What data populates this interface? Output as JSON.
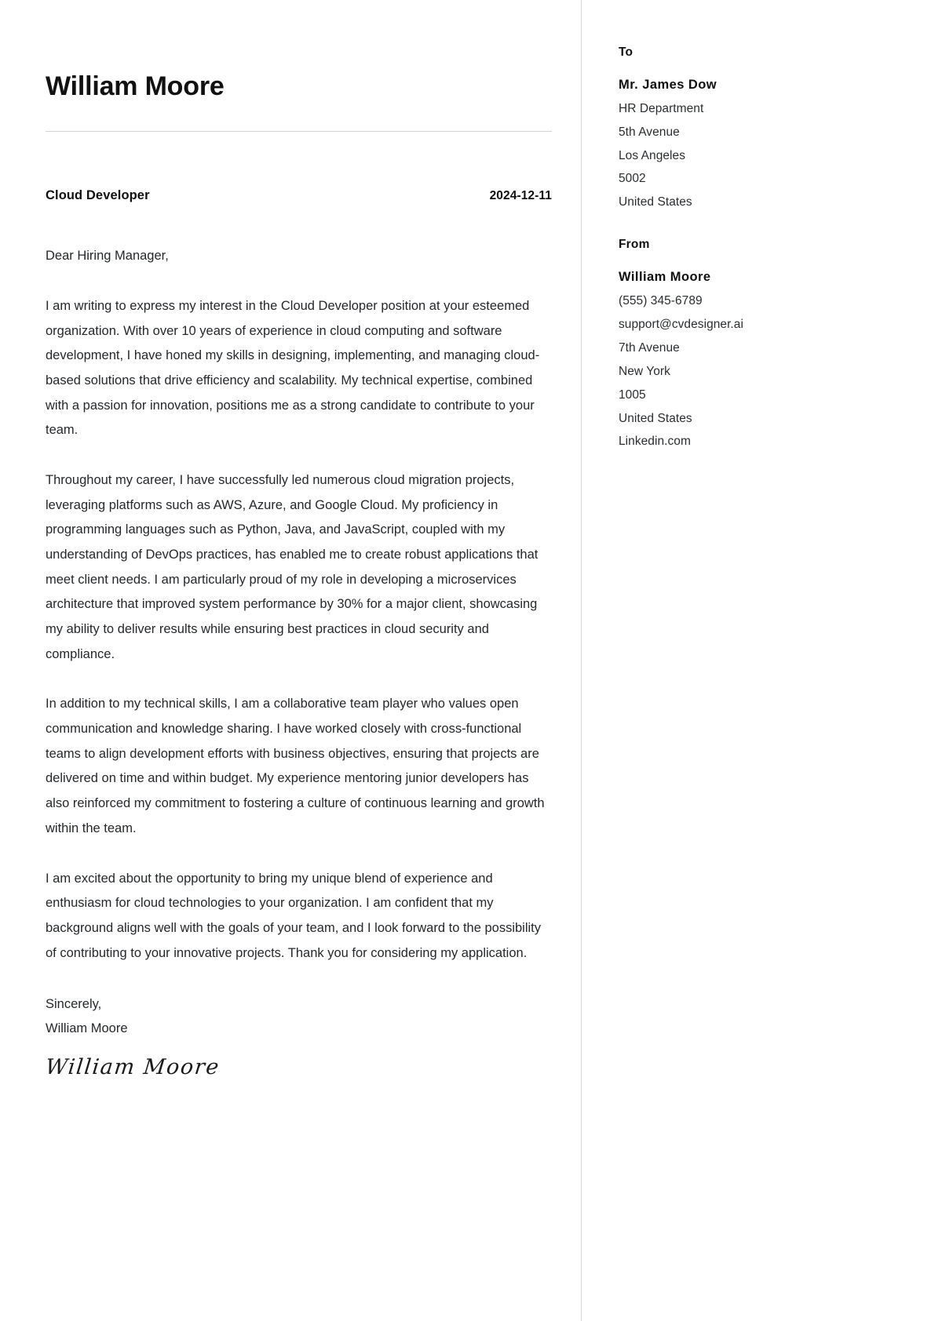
{
  "document": {
    "type": "cover-letter",
    "applicant_name": "William Moore",
    "job_title": "Cloud Developer",
    "date": "2024-12-11",
    "salutation": "Dear Hiring Manager,",
    "paragraphs": [
      "I am writing to express my interest in the Cloud Developer position at your esteemed organization. With over 10 years of experience in cloud computing and software development, I have honed my skills in designing, implementing, and managing cloud-based solutions that drive efficiency and scalability. My technical expertise, combined with a passion for innovation, positions me as a strong candidate to contribute to your team.",
      "Throughout my career, I have successfully led numerous cloud migration projects, leveraging platforms such as AWS, Azure, and Google Cloud. My proficiency in programming languages such as Python, Java, and JavaScript, coupled with my understanding of DevOps practices, has enabled me to create robust applications that meet client needs. I am particularly proud of my role in developing a microservices architecture that improved system performance by 30% for a major client, showcasing my ability to deliver results while ensuring best practices in cloud security and compliance.",
      "In addition to my technical skills, I am a collaborative team player who values open communication and knowledge sharing. I have worked closely with cross-functional teams to align development efforts with business objectives, ensuring that projects are delivered on time and within budget. My experience mentoring junior developers has also reinforced my commitment to fostering a culture of continuous learning and growth within the team.",
      "I am excited about the opportunity to bring my unique blend of experience and enthusiasm for cloud technologies to your organization. I am confident that my background aligns well with the goals of your team, and I look forward to the possibility of contributing to your innovative projects. Thank you for considering my application."
    ],
    "closing": {
      "valediction": "Sincerely,",
      "signer_name": "William Moore",
      "signature_script": "William Moore"
    }
  },
  "sidebar": {
    "to": {
      "heading": "To",
      "recipient_name": "Mr. James Dow",
      "lines": [
        "HR Department",
        "5th Avenue",
        "Los Angeles",
        "5002",
        "United States"
      ]
    },
    "from": {
      "heading": "From",
      "sender_name": "William Moore",
      "lines": [
        "(555) 345-6789",
        "support@cvdesigner.ai",
        "7th Avenue",
        "New York",
        "1005",
        "United States",
        "Linkedin.com"
      ]
    }
  },
  "colors": {
    "page_background": "#ffffff",
    "heading_text": "#111111",
    "body_text": "#25282b",
    "divider": "#d8d8d8",
    "rule": "#d3d3d3"
  }
}
